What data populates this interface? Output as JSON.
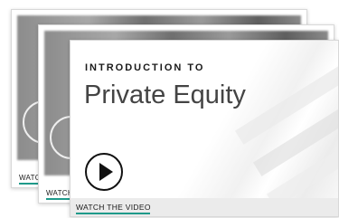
{
  "cards": {
    "back_2": {
      "caption": "WATCH"
    },
    "back_1": {
      "caption": "WATCH"
    },
    "front": {
      "eyebrow": "INTRODUCTION TO",
      "title": "Private Equity",
      "caption": "WATCH THE VIDEO",
      "play_icon": "play-icon"
    }
  },
  "colors": {
    "accent_underline": "#1f9a8a",
    "title_text": "#444444"
  }
}
